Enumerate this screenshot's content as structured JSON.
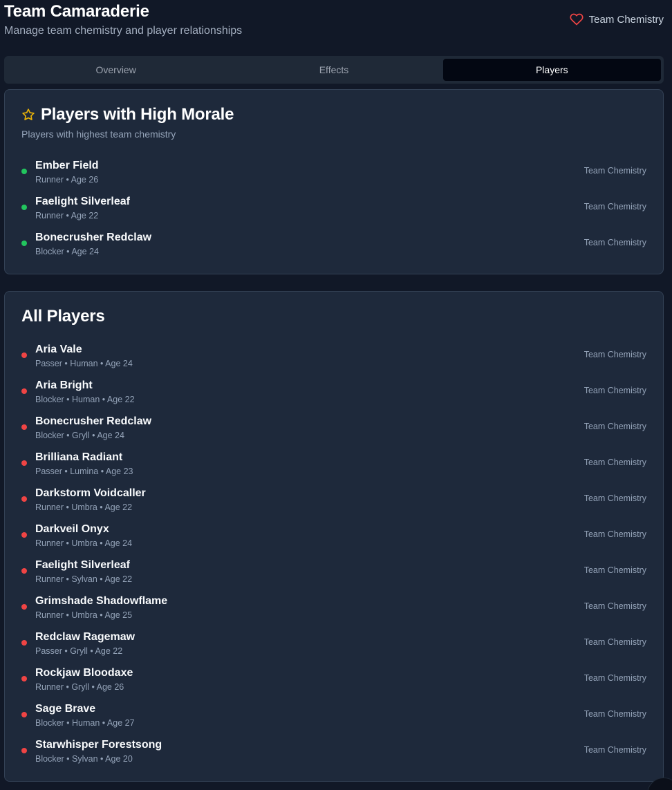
{
  "header": {
    "title": "Team Camaraderie",
    "subtitle": "Manage team chemistry and player relationships",
    "badge_icon": "heart-icon",
    "badge_label": "Team Chemistry"
  },
  "tabs": [
    {
      "label": "Overview",
      "active": false
    },
    {
      "label": "Effects",
      "active": false
    },
    {
      "label": "Players",
      "active": true
    }
  ],
  "high_morale": {
    "icon": "star-icon",
    "title": "Players with High Morale",
    "description": "Players with highest team chemistry",
    "players": [
      {
        "name": "Ember Field",
        "meta": "Runner • Age 26",
        "tag": "Team Chemistry",
        "status": "green"
      },
      {
        "name": "Faelight Silverleaf",
        "meta": "Runner • Age 22",
        "tag": "Team Chemistry",
        "status": "green"
      },
      {
        "name": "Bonecrusher Redclaw",
        "meta": "Blocker • Age 24",
        "tag": "Team Chemistry",
        "status": "green"
      }
    ]
  },
  "all_players": {
    "title": "All Players",
    "players": [
      {
        "name": "Aria Vale",
        "meta": "Passer • Human • Age 24",
        "tag": "Team Chemistry",
        "status": "red"
      },
      {
        "name": "Aria Bright",
        "meta": "Blocker • Human • Age 22",
        "tag": "Team Chemistry",
        "status": "red"
      },
      {
        "name": "Bonecrusher Redclaw",
        "meta": "Blocker • Gryll • Age 24",
        "tag": "Team Chemistry",
        "status": "red"
      },
      {
        "name": "Brilliana Radiant",
        "meta": "Passer • Lumina • Age 23",
        "tag": "Team Chemistry",
        "status": "red"
      },
      {
        "name": "Darkstorm Voidcaller",
        "meta": "Runner • Umbra • Age 22",
        "tag": "Team Chemistry",
        "status": "red"
      },
      {
        "name": "Darkveil Onyx",
        "meta": "Runner • Umbra • Age 24",
        "tag": "Team Chemistry",
        "status": "red"
      },
      {
        "name": "Faelight Silverleaf",
        "meta": "Runner • Sylvan • Age 22",
        "tag": "Team Chemistry",
        "status": "red"
      },
      {
        "name": "Grimshade Shadowflame",
        "meta": "Runner • Umbra • Age 25",
        "tag": "Team Chemistry",
        "status": "red"
      },
      {
        "name": "Redclaw Ragemaw",
        "meta": "Passer • Gryll • Age 22",
        "tag": "Team Chemistry",
        "status": "red"
      },
      {
        "name": "Rockjaw Bloodaxe",
        "meta": "Runner • Gryll • Age 26",
        "tag": "Team Chemistry",
        "status": "red"
      },
      {
        "name": "Sage Brave",
        "meta": "Blocker • Human • Age 27",
        "tag": "Team Chemistry",
        "status": "red"
      },
      {
        "name": "Starwhisper Forestsong",
        "meta": "Blocker • Sylvan • Age 20",
        "tag": "Team Chemistry",
        "status": "red"
      }
    ]
  },
  "colors": {
    "background": "#111827",
    "card": "#1e293b",
    "status_green": "#22c55e",
    "status_red": "#ef4444",
    "star": "#eab308",
    "heart": "#ef4444"
  }
}
